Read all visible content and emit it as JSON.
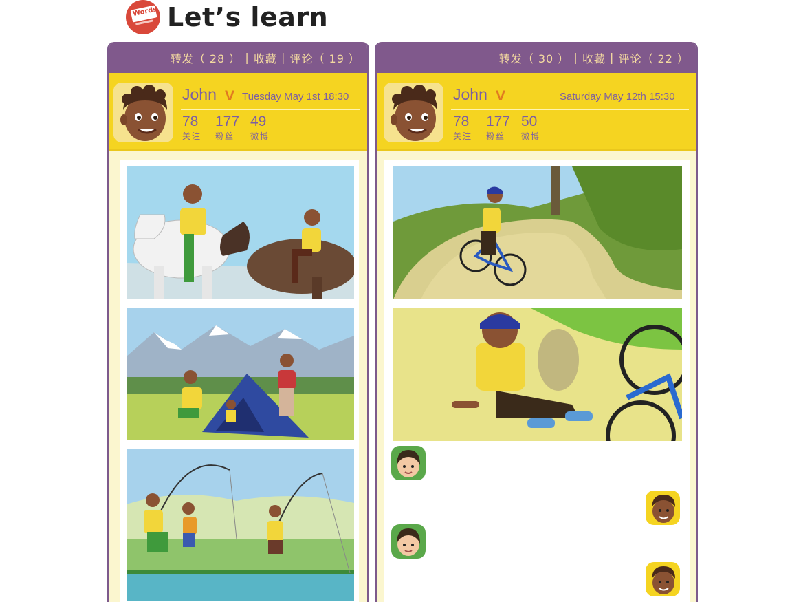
{
  "header": {
    "logo_text": "Words",
    "title": "Let’s learn"
  },
  "posts": [
    {
      "topbar": {
        "forward": "转发（ 28 ）",
        "favorite": "收藏",
        "comment": "评论（ 19 ）",
        "sep": " | "
      },
      "profile": {
        "name": "John",
        "verified_mark": "V",
        "date": "Tuesday  May 1st  18:30",
        "stats": [
          {
            "value": "78",
            "label": "关注"
          },
          {
            "value": "177",
            "label": "粉丝"
          },
          {
            "value": "49",
            "label": "微博"
          }
        ]
      },
      "photos": [
        "riding horses",
        "camping",
        "fishing"
      ]
    },
    {
      "topbar": {
        "forward": "转发（ 30 ）",
        "favorite": "收藏",
        "comment": "评论（ 22 ）",
        "sep": " | "
      },
      "profile": {
        "name": "John",
        "verified_mark": "V",
        "date": "Saturday  May 12th  15:30",
        "stats": [
          {
            "value": "78",
            "label": "关注"
          },
          {
            "value": "177",
            "label": "粉丝"
          },
          {
            "value": "50",
            "label": "微博"
          }
        ]
      },
      "photos": [
        "riding a bike",
        "fell off bike"
      ]
    }
  ],
  "colors": {
    "panel_border": "#7d5a8c",
    "topbar_bg": "#80598c",
    "topbar_text": "#f3d9a0",
    "profile_bg": "#f5d421",
    "name_text": "#7b5ea3",
    "verified": "#e07a20"
  }
}
